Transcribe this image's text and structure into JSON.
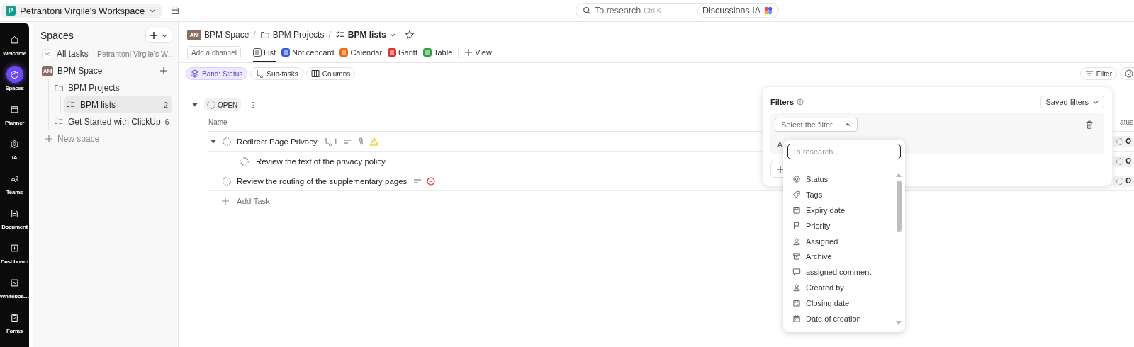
{
  "topbar": {
    "workspace": "Petrantoni Virgile's Workspace",
    "workspace_initial": "P",
    "search": {
      "placeholder": "To research",
      "shortcut": "Ctrl K"
    },
    "ai_button": "Discussions IA"
  },
  "rail": [
    {
      "label": "Welcome",
      "selected": false
    },
    {
      "label": "Spaces",
      "selected": true
    },
    {
      "label": "Planner",
      "selected": false
    },
    {
      "label": "IA",
      "selected": false
    },
    {
      "label": "Teams",
      "selected": false
    },
    {
      "label": "Document",
      "selected": false
    },
    {
      "label": "Dashboard",
      "selected": false
    },
    {
      "label": "Whiteboa…",
      "selected": false
    },
    {
      "label": "Forms",
      "selected": false
    }
  ],
  "sidebar": {
    "title": "Spaces",
    "all_tasks": {
      "label": "All tasks",
      "workspace": "- Petrantoni Virgile's W…"
    },
    "items": [
      {
        "label": "BPM Space",
        "avatar": "ANI",
        "selected": false,
        "children": [
          {
            "label": "BPM Projects",
            "kind": "folder",
            "selected": false,
            "children": [
              {
                "label": "BPM lists",
                "kind": "list",
                "count": "2",
                "selected": true
              }
            ]
          },
          {
            "label": "Get Started with ClickUp",
            "kind": "list",
            "count": "6",
            "selected": false
          }
        ]
      }
    ],
    "new_space": "New space"
  },
  "breadcrumb": [
    {
      "label": "BPM Space",
      "avatar": "ANI"
    },
    {
      "sep": "/",
      "label": "BPM Projects"
    },
    {
      "sep": "/",
      "label": "BPM lists"
    }
  ],
  "add_channel": "Add a channel",
  "tabs": [
    {
      "label": "List",
      "selected": true,
      "color": "#555555"
    },
    {
      "label": "Noticeboard",
      "selected": false,
      "color": "#3b5bdb"
    },
    {
      "label": "Calendar",
      "selected": false,
      "color": "#f76707"
    },
    {
      "label": "Gantt",
      "selected": false,
      "color": "#e03131"
    },
    {
      "label": "Table",
      "selected": false,
      "color": "#2f9e44"
    }
  ],
  "add_view": "View",
  "toolbar": [
    {
      "label": "Band: Status",
      "selected": true
    },
    {
      "label": "Sub-tasks",
      "selected": false
    },
    {
      "label": "Columns",
      "selected": false
    }
  ],
  "filter_button": "Filter",
  "group": {
    "status": "OPEN",
    "count": "2",
    "expanded": true
  },
  "table": {
    "columns": [
      {
        "label": "Name"
      },
      {
        "label": "atus"
      }
    ],
    "rows": [
      {
        "name": "Redirect Page Privacy",
        "subtasks": "1",
        "expanded": true,
        "status": "O",
        "children": [
          {
            "name": "Review the text of the privacy policy",
            "status": "O"
          }
        ]
      },
      {
        "name": "Review the routing of the supplementary pages",
        "status": "O"
      }
    ],
    "add_task": "Add Task"
  },
  "filters": {
    "title": "Filters",
    "saved": "Saved filters",
    "select": {
      "placeholder": "Select the filter",
      "expanded": true
    },
    "hidden_label": "A",
    "dropdown": {
      "search": {
        "placeholder": "To research..."
      },
      "items": [
        "Status",
        "Tags",
        "Expiry date",
        "Priority",
        "Assigned",
        "Archive",
        "assigned comment",
        "Created by",
        "Closing date",
        "Date of creation"
      ]
    }
  }
}
